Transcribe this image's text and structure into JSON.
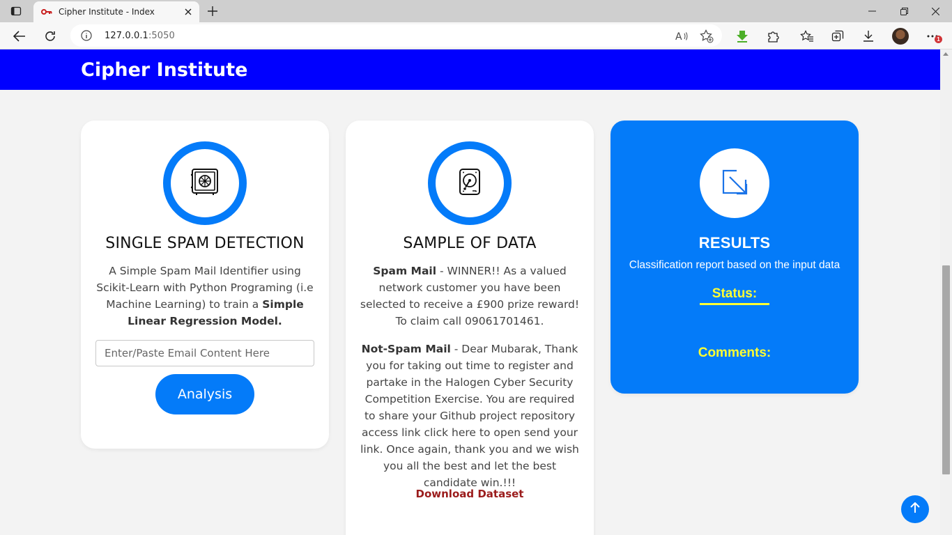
{
  "browser": {
    "tab_title": "Cipher Institute - Index",
    "url_host": "127.0.0.1",
    "url_port": ":5050",
    "notification_count": "1"
  },
  "header": {
    "site_title": "Cipher Institute",
    "bg_color": "#0000ff"
  },
  "cards": {
    "single": {
      "icon": "safe-icon",
      "heading": "SINGLE SPAM DETECTION",
      "desc_part1": "A Simple Spam Mail Identifier using Scikit-Learn with Python Programing (i.e Machine Learning) to train a ",
      "desc_bold": "Simple Linear Regression Model.",
      "input_placeholder": "Enter/Paste Email Content Here",
      "button_label": "Analysis"
    },
    "sample": {
      "icon": "hard-drive-icon",
      "heading": "SAMPLE OF DATA",
      "spam_label": "Spam Mail",
      "spam_text": " - WINNER!! As a valued network customer you have been selected to receive a £900 prize reward! To claim call 09061701461.",
      "notspam_label": "Not-Spam Mail",
      "notspam_text": " - Dear Mubarak, Thank you for taking out time to register and partake in the Halogen Cyber Security Competition Exercise. You are required to share your Github project repository access link click here to open send your link. Once again, thank you and we wish you all the best and let the best candidate win.!!!",
      "download_label": "Download Dataset"
    },
    "results": {
      "icon": "arrow-down-right-icon",
      "heading": "RESULTS",
      "subtitle": "Classification report based on the input data",
      "status_label": "Status:",
      "comments_label": "Comments:"
    }
  },
  "colors": {
    "accent": "#047bf9",
    "highlight": "#ffff33",
    "download_link": "#9b1c1c"
  }
}
